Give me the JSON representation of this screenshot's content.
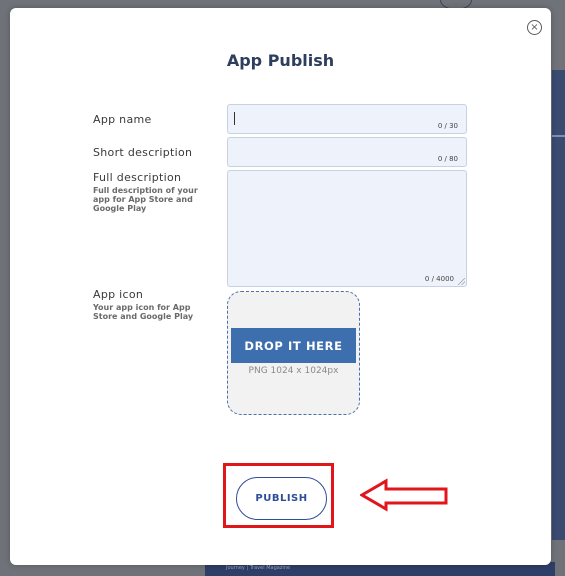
{
  "modal": {
    "title": "App Publish",
    "close_icon": "close-circle-icon"
  },
  "form": {
    "app_name": {
      "label": "App name",
      "value": "",
      "counter": "0 / 30"
    },
    "short_description": {
      "label": "Short description",
      "value": "",
      "counter": "0 / 80"
    },
    "full_description": {
      "label": "Full description",
      "hint": "Full description of your app for App Store and Google Play",
      "value": "",
      "counter": "0 / 4000"
    },
    "app_icon": {
      "label": "App icon",
      "hint": "Your app icon for App Store and Google Play",
      "drop_label": "DROP IT HERE",
      "drop_hint": "PNG 1024 x 1024px"
    }
  },
  "actions": {
    "publish_label": "PUBLISH"
  },
  "annotation": {
    "highlight_color": "#e0161b",
    "arrow_icon": "left-arrow-icon"
  },
  "background": {
    "footer_text": "Journey | Travel Magazine"
  },
  "colors": {
    "title": "#2d3f5c",
    "field_bg": "#eef2fa",
    "drop_button": "#3d6fae",
    "publish_border": "#2f4d9a"
  }
}
